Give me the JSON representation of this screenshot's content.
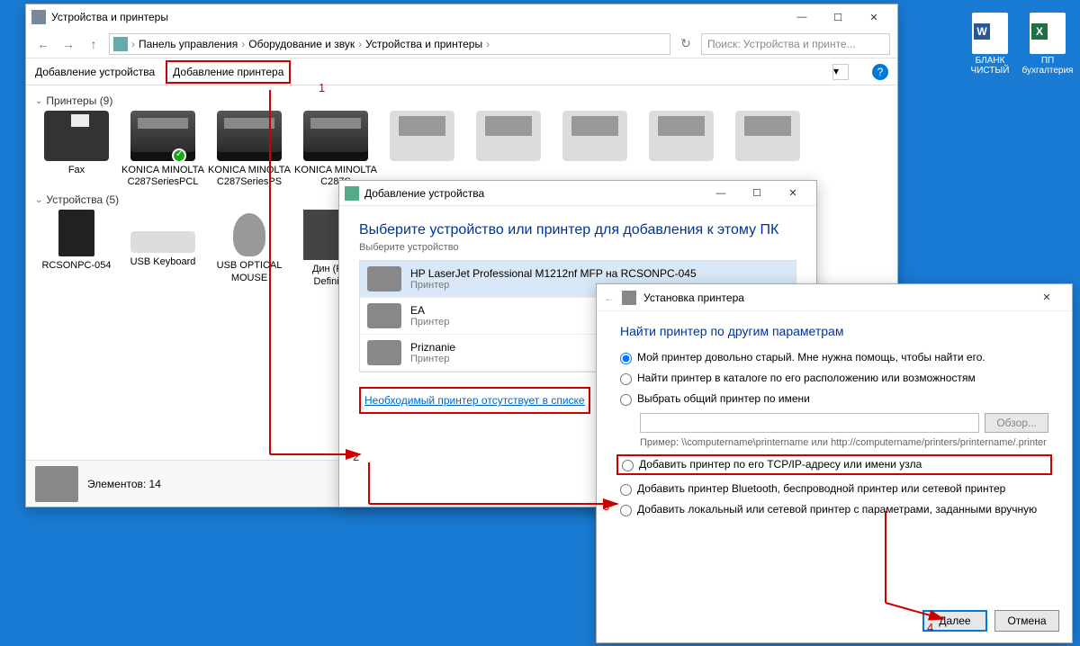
{
  "explorer": {
    "title": "Устройства и принтеры",
    "breadcrumb": [
      "Панель управления",
      "Оборудование и звук",
      "Устройства и принтеры"
    ],
    "search_placeholder": "Поиск: Устройства и принте...",
    "toolbar": {
      "add_device": "Добавление устройства",
      "add_printer": "Добавление принтера"
    },
    "groups": {
      "printers": {
        "label": "Принтеры (9)"
      },
      "devices": {
        "label": "Устройства (5)"
      }
    },
    "printers": [
      {
        "name": "Fax"
      },
      {
        "name": "KONICA MINOLTA C287SeriesPCL",
        "check": true
      },
      {
        "name": "KONICA MINOLTA C287SeriesPS"
      },
      {
        "name": "KONICA MINOLTA C287S"
      },
      {
        "name": ""
      },
      {
        "name": ""
      },
      {
        "name": ""
      },
      {
        "name": ""
      },
      {
        "name": ""
      }
    ],
    "devices": [
      {
        "name": "RCSONPC-054"
      },
      {
        "name": "USB Keyboard"
      },
      {
        "name": "USB OPTICAL MOUSE"
      },
      {
        "name": "Дин (Realt Definitio..."
      }
    ],
    "status": "Элементов: 14"
  },
  "dialog_add": {
    "title": "Добавление устройства",
    "heading": "Выберите устройство или принтер для добавления к этому ПК",
    "sub": "Выберите устройство",
    "items": [
      {
        "name": "HP LaserJet Professional M1212nf MFP на RCSONPC-045",
        "type": "Принтер",
        "sel": true
      },
      {
        "name": "EA",
        "type": "Принтер"
      },
      {
        "name": "Priznanie",
        "type": "Принтер"
      }
    ],
    "link": "Необходимый принтер отсутствует в списке"
  },
  "dialog_find": {
    "title": "Установка принтера",
    "heading": "Найти принтер по другим параметрам",
    "options": [
      "Мой принтер довольно старый. Мне нужна помощь, чтобы найти его.",
      "Найти принтер в каталоге по его расположению или возможностям",
      "Выбрать общий принтер по имени",
      "Добавить принтер по его TCP/IP-адресу или имени узла",
      "Добавить принтер Bluetooth, беспроводной принтер или сетевой принтер",
      "Добавить локальный или сетевой принтер с параметрами, заданными вручную"
    ],
    "browse": "Обзор...",
    "hint": "Пример: \\\\computername\\printername или http://computername/printers/printername/.printer",
    "next": "Далее",
    "cancel": "Отмена"
  },
  "desktop": {
    "word": "БЛАНК ЧИСТЫЙ",
    "excel": "ПП бухгалтерия"
  },
  "annotations": {
    "n1": "1",
    "n2": "2",
    "n3": "3",
    "n4": "4"
  }
}
